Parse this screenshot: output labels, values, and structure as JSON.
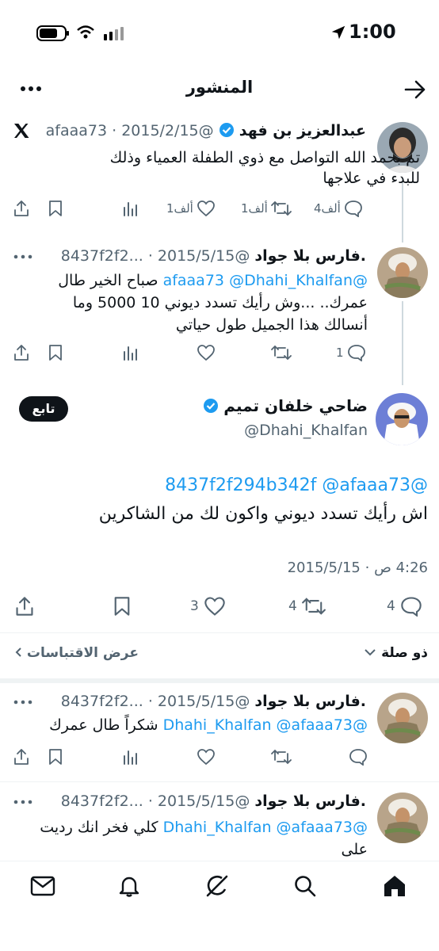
{
  "status_bar": {
    "time": "1:00"
  },
  "header": {
    "title": "المنشور"
  },
  "tweets": [
    {
      "name": "عبدالعزيز بن فهد",
      "handle": "@afaaa73",
      "date": "2015/2/15",
      "text_line1": "تم بحمد الله التواصل مع ذوي الطفلة العمياء وذلك",
      "text_line2": "للبدء في علاجها",
      "replies": "4ألف",
      "retweets": "1ألف",
      "likes": "1ألف"
    },
    {
      "name": ".فارس بلا جواد",
      "handle": "@8437f2f2...",
      "date": "2015/5/15",
      "mention1": "@Dhahi_Khalfan",
      "mention2": "@afaaa73",
      "text_line1": "صباح الخير طال",
      "text_line2": "عمرك.. ...وش رأيك تسدد ديوني 10 5000 وما",
      "text_line3": "أنسالك هذا الجميل طول حياتي",
      "replies": "1"
    }
  ],
  "main_tweet": {
    "name": "ضاحي خلفان تميم",
    "handle": "@Dhahi_Khalfan",
    "follow_label": "تابع",
    "mentions": "@8437f2f294b342f @afaaa73",
    "text": "اش  رأيك تسدد ديوني  واكون لك من الشاكرين",
    "date": "2015/5/15",
    "time": "4:26 ص",
    "replies": "4",
    "retweets": "4",
    "likes": "3"
  },
  "relevance": {
    "sort_label": "ذو صلة",
    "quotes_label": "عرض الاقتباسات"
  },
  "replies": [
    {
      "name": ".فارس بلا جواد",
      "handle": "@8437f2f2...",
      "date": "2015/5/15",
      "mentions": "@Dhahi_Khalfan @afaaa73",
      "text": "شكراً طال عمرك"
    },
    {
      "name": ".فارس بلا جواد",
      "handle": "@8437f2f2...",
      "date": "2015/5/15",
      "mentions": "@Dhahi_Khalfan @afaaa73",
      "text": "كلي فخر انك رديت",
      "text2": "على"
    }
  ],
  "bottom_nav": [
    "home",
    "search",
    "grok",
    "notifications",
    "messages"
  ]
}
